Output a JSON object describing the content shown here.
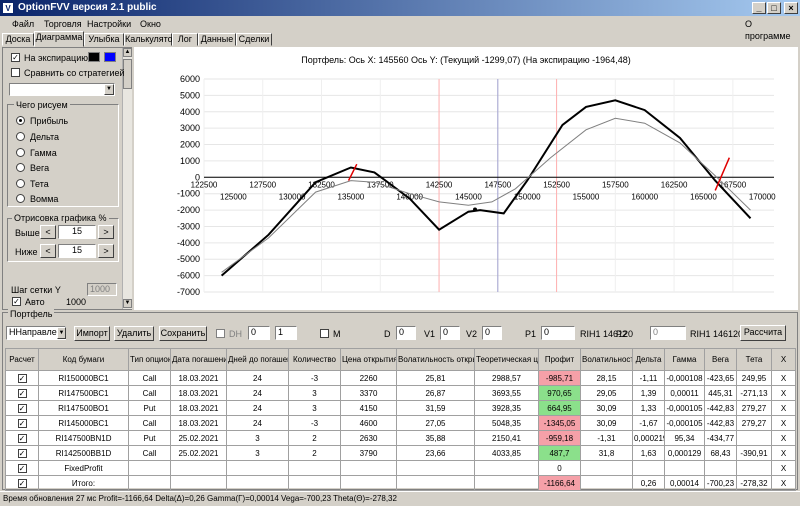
{
  "window": {
    "title": "OptionFVV версия 2.1 public",
    "about": "О программе"
  },
  "menu": [
    "Файл",
    "Торговля",
    "Настройки",
    "Окно"
  ],
  "tabs": [
    "Доска",
    "Диаграмма",
    "Улыбка",
    "Калькулятор",
    "Лог",
    "Данные",
    "Сделки"
  ],
  "left": {
    "expiry_label": "На экспирацию",
    "compare_label": "Сравнить со стратегией",
    "draw_group": "Чего рисуем",
    "radios": [
      "Прибыль",
      "Дельта",
      "Гамма",
      "Вега",
      "Тета",
      "Вомма"
    ],
    "range_group": "Отрисовка графика %",
    "above_label": "Выше",
    "above_value": "15",
    "below_label": "Ниже",
    "below_value": "15",
    "grid_step_label": "Шаг сетки Y",
    "grid_step_value": "1000",
    "auto_label": "Авто",
    "auto_value": "1000",
    "colors": {
      "expiry": "#000000",
      "current": "#0000ff"
    }
  },
  "chart_header": "Портфель: Ось X: 145560 Ось Y: (Текущий -1299,07) (На экспирацию -1964,48)",
  "chart_data": {
    "type": "line",
    "x_ticks_top": [
      "122500",
      "127500",
      "132500",
      "137500",
      "142500",
      "147500",
      "152500",
      "157500",
      "162500",
      "167500"
    ],
    "x_ticks_bottom": [
      "125000",
      "130000",
      "135000",
      "140000",
      "145000",
      "150000",
      "155000",
      "160000",
      "165000",
      "170000"
    ],
    "y_ticks": [
      "6000",
      "5000",
      "4000",
      "3000",
      "2000",
      "1000",
      "0",
      "-1000",
      "-2000",
      "-3000",
      "-4000",
      "-5000",
      "-6000",
      "-7000"
    ],
    "xlim": [
      122500,
      171000
    ],
    "ylim": [
      -7000,
      6000
    ],
    "series": [
      {
        "key": "expiry",
        "color": "#000000",
        "x": [
          124000,
          128000,
          132000,
          135000,
          137000,
          140000,
          142500,
          145000,
          146000,
          148000,
          150000,
          153000,
          155000,
          157500,
          160000,
          163000,
          166000,
          169000
        ],
        "y": [
          -6000,
          -3500,
          -300,
          600,
          300,
          -1300,
          -3200,
          -2100,
          -2000,
          -2200,
          -200,
          3200,
          4300,
          4700,
          4100,
          2400,
          -200,
          -2500
        ]
      },
      {
        "key": "current",
        "color": "#808080",
        "x": [
          124000,
          128000,
          132000,
          135000,
          137000,
          140000,
          142500,
          145000,
          147000,
          149000,
          152000,
          155000,
          157500,
          160000,
          163000,
          166000,
          169000
        ],
        "y": [
          -5800,
          -3700,
          -900,
          -200,
          -300,
          -1000,
          -1500,
          -1700,
          -1500,
          -700,
          1200,
          2900,
          3600,
          3300,
          2100,
          100,
          -2000
        ]
      }
    ]
  },
  "portfolio": {
    "title": "Портфель",
    "direction": "HНаправле",
    "import": "Импорт",
    "delete": "Удалить",
    "save": "Сохранить",
    "dh": "DH",
    "dh_val": "0",
    "dh_val2": "1",
    "m": "M",
    "d_label": "D",
    "d_val": "0",
    "v1_label": "V1",
    "v1_val": "0",
    "v2_label": "V2",
    "v2_val": "0",
    "p1_label": "P1",
    "p1_val": "0",
    "p1_name": "RIH1 146120",
    "p2_label": "P2",
    "p2_val": "0",
    "p2_name": "RIH1 146120",
    "calc": "Рассчита"
  },
  "table": {
    "headers": [
      "Расчет",
      "Код бумаги",
      "Тип опциона",
      "Дата погашения",
      "Дней до погашения",
      "Количество",
      "Цена открытия",
      "Волатильность открытия",
      "Теоретическая цена",
      "Профит",
      "Волатильность",
      "Дельта",
      "Гамма",
      "Вега",
      "Тета",
      "X"
    ],
    "rows": [
      [
        "✓",
        "RI150000BC1",
        "Call",
        "18.03.2021",
        "24",
        "-3",
        "2260",
        "25,81",
        "2988,57",
        "-985,71",
        "28,15",
        "-1,11",
        "-0,000108",
        "-423,65",
        "249,95",
        "X"
      ],
      [
        "✓",
        "RI147500BC1",
        "Call",
        "18.03.2021",
        "24",
        "3",
        "3370",
        "26,87",
        "3693,55",
        "970,65",
        "29,05",
        "1,39",
        "0,00011",
        "445,31",
        "-271,13",
        "X"
      ],
      [
        "✓",
        "RI147500BO1",
        "Put",
        "18.03.2021",
        "24",
        "3",
        "4150",
        "31,59",
        "3928,35",
        "664,95",
        "30,09",
        "1,33",
        "-0,000105",
        "-442,83",
        "279,27",
        "X"
      ],
      [
        "✓",
        "RI145000BC1",
        "Call",
        "18.03.2021",
        "24",
        "-3",
        "4600",
        "27,05",
        "5048,35",
        "-1345,05",
        "30,09",
        "-1,67",
        "-0,000105",
        "-442,83",
        "279,27",
        "X"
      ],
      [
        "✓",
        "RI147500BN1D",
        "Put",
        "25.02.2021",
        "3",
        "2",
        "2630",
        "35,88",
        "2150,41",
        "-959,18",
        "-1,31",
        "0,000219",
        "95,34",
        "-434,77",
        "",
        "X"
      ],
      [
        "✓",
        "RI142500BB1D",
        "Call",
        "25.02.2021",
        "3",
        "2",
        "3790",
        "23,66",
        "4033,85",
        "487,7",
        "31,8",
        "1,63",
        "0,000129",
        "68,43",
        "-390,91",
        "X"
      ],
      [
        "✓",
        "FixedProfit",
        "",
        "",
        "",
        "",
        "",
        "",
        "",
        "0",
        "",
        "",
        "",
        "",
        "",
        "X"
      ],
      [
        "✓",
        "Итого:",
        "",
        "",
        "",
        "",
        "",
        "",
        "",
        "-1166,64",
        "",
        "0,26",
        "0,00014",
        "-700,23",
        "-278,32",
        "X"
      ]
    ],
    "profit_class": [
      "neg",
      "pos",
      "pos",
      "neg",
      "neg",
      "pos",
      "",
      "neg"
    ]
  },
  "status": "Время обновления 27 мс  Profit=-1166,64 Delta(Δ)=0,26 Gamma(Γ)=0,00014 Vega=-700,23 Theta(Θ)=-278,32"
}
